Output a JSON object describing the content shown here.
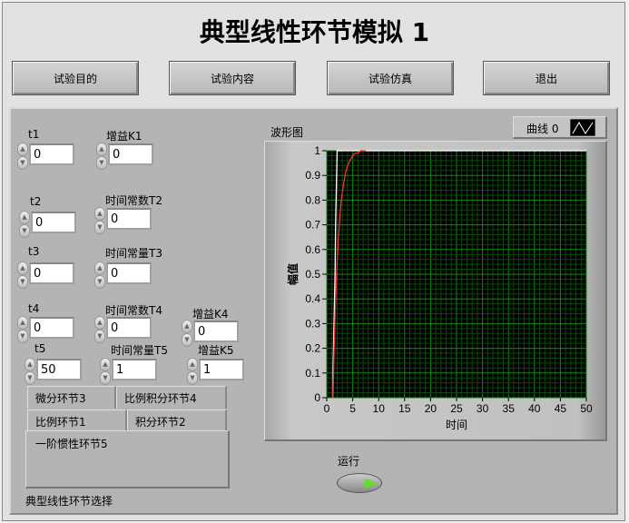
{
  "title": "典型线性环节模拟 1",
  "buttons": [
    "试验目的",
    "试验内容",
    "试验仿真",
    "退出"
  ],
  "controls": {
    "t1": {
      "label": "t1",
      "value": "0"
    },
    "K1": {
      "label": "增益K1",
      "value": "0"
    },
    "t2": {
      "label": "t2",
      "value": "0"
    },
    "T2": {
      "label": "时间常数T2",
      "value": "0"
    },
    "t3": {
      "label": "t3",
      "value": "0"
    },
    "T3": {
      "label": "时间常量T3",
      "value": "0"
    },
    "t4": {
      "label": "t4",
      "value": "0"
    },
    "T4": {
      "label": "时间常数T4",
      "value": "0"
    },
    "K4": {
      "label": "增益K4",
      "value": "0"
    },
    "t5": {
      "label": "t5",
      "value": "50"
    },
    "T5": {
      "label": "时间常量T5",
      "value": "1"
    },
    "K5": {
      "label": "增益K5",
      "value": "1"
    }
  },
  "tabs": [
    "微分环节3",
    "比例积分环节4",
    "比例环节1",
    "积分环节2",
    "一阶惯性环节5"
  ],
  "selector_label": "典型线性环节选择",
  "graph": {
    "label": "波形图",
    "legend": "曲线 0"
  },
  "run_label": "运行",
  "chart_data": {
    "type": "line",
    "xlabel": "时间",
    "ylabel": "幅值",
    "xlim": [
      0,
      50
    ],
    "ylim": [
      0,
      1
    ],
    "xticks": [
      0,
      5,
      10,
      15,
      20,
      25,
      30,
      35,
      40,
      45,
      50
    ],
    "yticks": [
      0,
      0.1,
      0.2,
      0.3,
      0.4,
      0.5,
      0.6,
      0.7,
      0.8,
      0.9,
      1
    ],
    "grid": true,
    "series": [
      {
        "name": "white",
        "color": "#ffffff",
        "x": [
          1.2,
          1.2,
          1.4,
          1.6,
          1.7,
          1.9,
          2.0,
          50
        ],
        "y": [
          0,
          0.1,
          0.3,
          0.5,
          0.7,
          0.9,
          1,
          1
        ]
      },
      {
        "name": "red",
        "color": "#ff3030",
        "x": [
          1.2,
          1.4,
          1.6,
          1.8,
          2.0,
          2.2,
          2.5,
          2.8,
          3.2,
          3.6,
          4,
          4.5,
          5,
          5.5,
          6,
          6.5,
          7,
          7.5
        ],
        "y": [
          0,
          0.18,
          0.33,
          0.45,
          0.55,
          0.63,
          0.73,
          0.8,
          0.86,
          0.91,
          0.94,
          0.96,
          0.98,
          0.99,
          0.99,
          1,
          1,
          1
        ]
      }
    ]
  }
}
